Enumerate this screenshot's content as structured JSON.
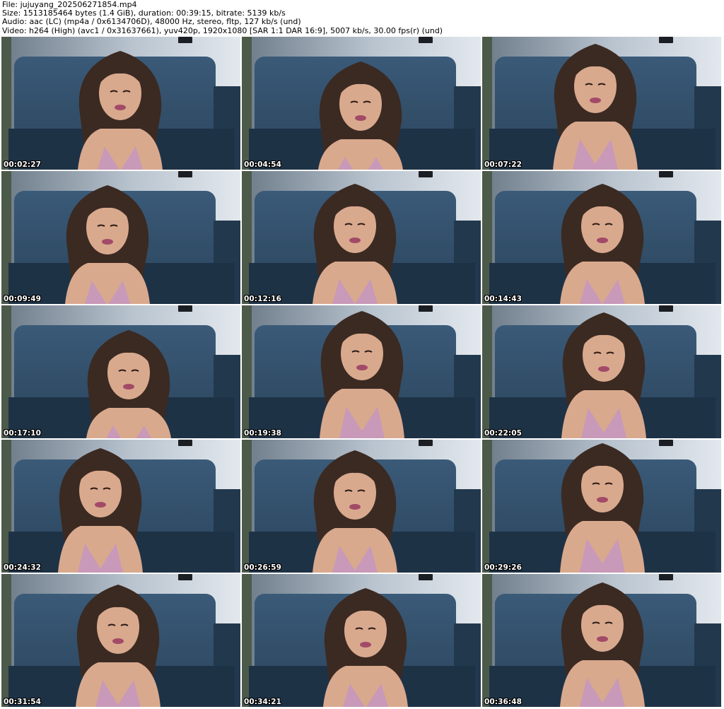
{
  "header": {
    "file_line": "File: jujuyang_202506271854.mp4",
    "size_line": "Size: 1513185464 bytes (1.4 GiB), duration: 00:39:15, bitrate: 5139 kb/s",
    "audio_line": "Audio: aac (LC) (mp4a / 0x6134706D), 48000 Hz, stereo, fltp, 127 kb/s (und)",
    "video_line": "Video: h264 (High) (avc1 / 0x31637661), yuv420p, 1920x1080 [SAR 1:1 DAR 16:9], 5007 kb/s, 30.00 fps(r) (und)"
  },
  "thumbnails": [
    {
      "timestamp": "00:02:27"
    },
    {
      "timestamp": "00:04:54"
    },
    {
      "timestamp": "00:07:22"
    },
    {
      "timestamp": "00:09:49"
    },
    {
      "timestamp": "00:12:16"
    },
    {
      "timestamp": "00:14:43"
    },
    {
      "timestamp": "00:17:10"
    },
    {
      "timestamp": "00:19:38"
    },
    {
      "timestamp": "00:22:05"
    },
    {
      "timestamp": "00:24:32"
    },
    {
      "timestamp": "00:26:59"
    },
    {
      "timestamp": "00:29:26"
    },
    {
      "timestamp": "00:31:54"
    },
    {
      "timestamp": "00:34:21"
    },
    {
      "timestamp": "00:36:48"
    }
  ],
  "colors": {
    "wall": "#b9c4cf",
    "sofa": "#2f4a63",
    "hair": "#3b2a22",
    "skin": "#d9a98e",
    "dress": "#c899b8",
    "timestamp_text": "#ffffff"
  }
}
